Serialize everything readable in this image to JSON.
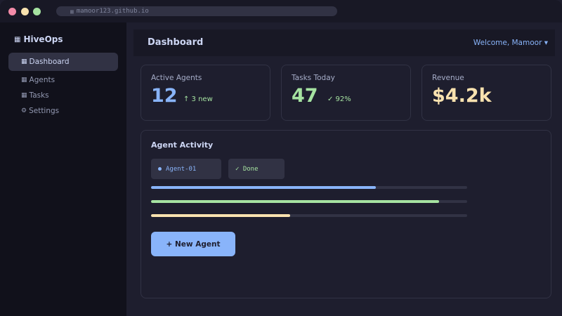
{
  "browser": {
    "url": "mamoor123.github.io",
    "url_icon": "grid-icon"
  },
  "sidebar": {
    "brand": "HiveOps",
    "brand_icon": "grid-icon",
    "items": [
      {
        "label": "Dashboard",
        "icon": "grid-icon",
        "active": true
      },
      {
        "label": "Agents",
        "icon": "grid-icon"
      },
      {
        "label": "Tasks",
        "icon": "grid-icon"
      },
      {
        "label": "Settings",
        "icon": "gear-icon"
      }
    ]
  },
  "header": {
    "title": "Dashboard",
    "welcome": "Welcome, Mamoor ▾"
  },
  "stats": [
    {
      "label": "Active Agents",
      "value": "12",
      "delta": "↑ 3 new"
    },
    {
      "label": "Tasks Today",
      "value": "47",
      "delta": "✓ 92%"
    },
    {
      "label": "Revenue",
      "value": "$4.2k"
    }
  ],
  "activity": {
    "title": "Agent Activity",
    "chips": [
      "Agent-01",
      "✓ Done"
    ],
    "progress": [
      0.71,
      0.91,
      0.44
    ],
    "button": "+ New Agent"
  },
  "colors": {
    "accent": "#89b4fa",
    "success": "#a6e3a1",
    "warning": "#f9e2af",
    "background": "#1e1e2e",
    "sidebar": "#11111b"
  }
}
